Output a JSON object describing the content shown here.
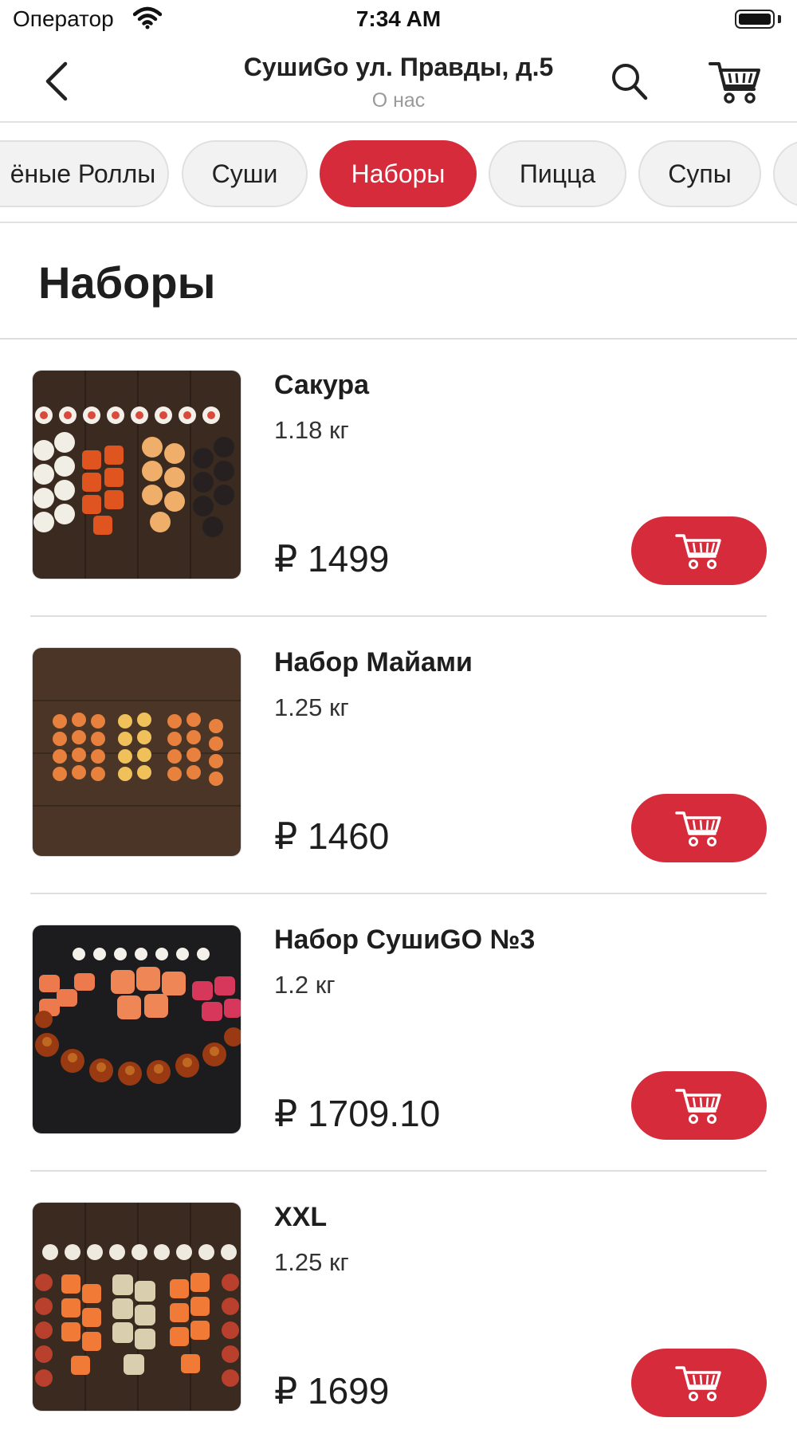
{
  "status_bar": {
    "carrier": "Оператор",
    "time": "7:34 AM"
  },
  "header": {
    "title": "СушиGo ул. Правды, д.5",
    "subtitle": "О нас",
    "icons": {
      "back": "chevron-left-icon",
      "search": "search-icon",
      "cart": "cart-icon"
    }
  },
  "categories": {
    "items": [
      {
        "label": "ёные Роллы",
        "active": false
      },
      {
        "label": "Суши",
        "active": false
      },
      {
        "label": "Наборы",
        "active": true
      },
      {
        "label": "Пицца",
        "active": false
      },
      {
        "label": "Супы",
        "active": false
      }
    ]
  },
  "section": {
    "title": "Наборы"
  },
  "products": [
    {
      "name": "Сакура",
      "weight": "1.18 кг",
      "price": "₽ 1499"
    },
    {
      "name": "Набор Майами",
      "weight": "1.25 кг",
      "price": "₽ 1460"
    },
    {
      "name": "Набор СушиGO №3",
      "weight": "1.2 кг",
      "price": "₽ 1709.10"
    },
    {
      "name": "XXL",
      "weight": "1.25 кг",
      "price": "₽ 1699"
    }
  ],
  "colors": {
    "accent": "#d52b3a",
    "chip_bg": "#f2f2f2",
    "divider": "#dedede"
  }
}
